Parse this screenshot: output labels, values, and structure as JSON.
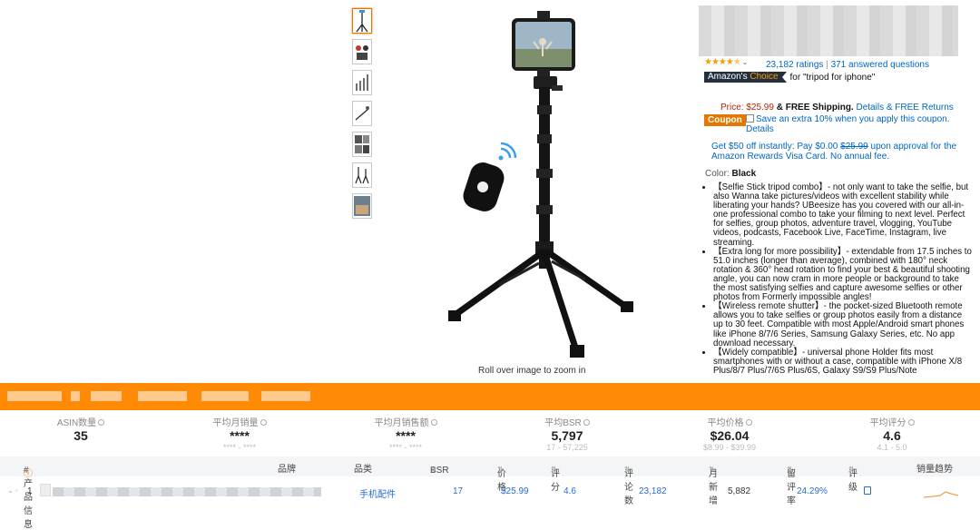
{
  "product": {
    "ratings_count": "23,182 ratings",
    "answered_questions": "371 answered questions",
    "badge_prefix": "Amazon's",
    "badge_suffix": "Choice",
    "badge_for": "for \"tripod for iphone\"",
    "price_label": "Price:",
    "price": "$25.99",
    "price_shipping": "& FREE Shipping.",
    "details_link": "Details",
    "free_returns": "& FREE Returns",
    "coupon_label": "Coupon",
    "coupon_text": "Save an extra 10% when you apply this coupon.",
    "coupon_details": "Details",
    "offer_text_1": "Get $50 off instantly: Pay $0.00",
    "offer_strike": "$25.99",
    "offer_text_2": "upon approval for the Amazon Rewards Visa Card. No annual fee.",
    "color_label": "Color:",
    "color_value": "Black",
    "rollover": "Roll over image to zoom in",
    "bullets": [
      "【Selfie Stick tripod combo】- not only want to take the selfie, but also Wanna take pictures/videos with excellent stability while liberating your hands? UBeesize has you covered with our all-in-one professional combo to take your filming to next level. Perfect for selfies, group photos, adventure travel, vlogging, YouTube videos, podcasts, Facebook Live, FaceTime, Instagram, live streaming.",
      "【Extra long for more possibility】- extendable from 17.5 inches to 51.0 inches (longer than average), combined with 180° neck rotation & 360° head rotation to find your best & beautiful shooting angle, you can now cram in more people or background to take the most satisfying selfies and capture awesome selfies or other photos from Formerly impossible angles!",
      "【Wireless remote shutter】- the pocket-sized Bluetooth remote allows you to take selfies or group photos easily from a distance up to 30 feet. Compatible with most Apple/Android smart phones like iPhone 8/7/6 Series, Samsung Galaxy Series, etc. No app download necessary.",
      "【Widely compatible】- universal phone Holder fits most smartphones with or without a case, compatible with iPhone X/8 Plus/8/7 Plus/7/6S Plus/6S, Galaxy S9/S9 Plus/Note"
    ],
    "rating_stars": 4.5,
    "star_color": "#f29e06"
  },
  "stats": [
    {
      "label": "ASIN数量",
      "value": "35",
      "sub": ""
    },
    {
      "label": "平均月销量",
      "value": "****",
      "sub": "**** - ****"
    },
    {
      "label": "平均月销售额",
      "value": "****",
      "sub": "**** - ****"
    },
    {
      "label": "平均BSR",
      "value": "5,797",
      "sub": "17 - 57,225"
    },
    {
      "label": "平均价格",
      "value": "$26.04",
      "sub": "$8.99 - $39.99"
    },
    {
      "label": "平均评分",
      "value": "4.6",
      "sub": "4.1 - 5.0"
    }
  ],
  "table": {
    "headers": [
      "# 产品信息",
      "品牌",
      "品类",
      "BSR",
      "价格",
      "评分",
      "评论数",
      "月新增",
      "留评率",
      "评级",
      "销量趋势"
    ],
    "row": {
      "index": "1",
      "category": "手机配件",
      "bsr": "17",
      "price": "$25.99",
      "rating": "4.6",
      "reviews": "23,182",
      "monthly_new": "5,882",
      "review_rate": "24.29%"
    }
  },
  "colors": {
    "accent_orange": "#ff8a06",
    "link": "#0066c0",
    "price_red": "#b12704"
  }
}
